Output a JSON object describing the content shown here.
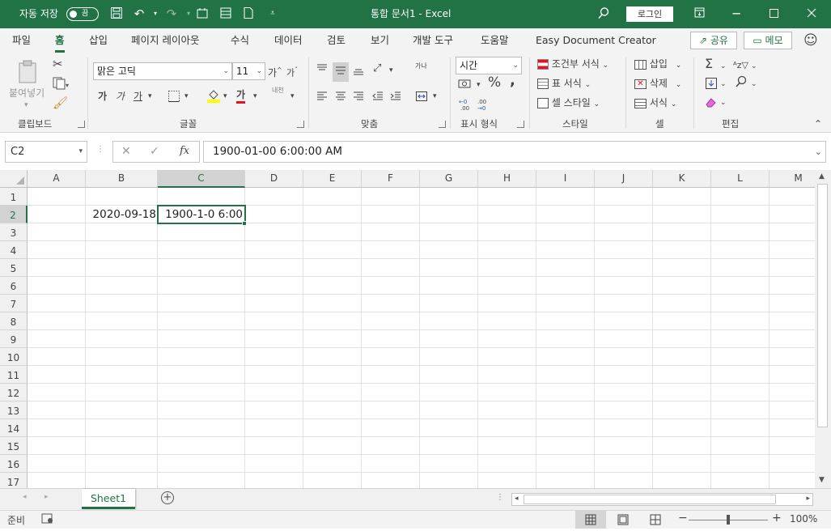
{
  "titlebar": {
    "autosave_label": "자동 저장",
    "autosave_state": "끔",
    "doc_title": "통합 문서1  -  Excel",
    "login_label": "로그인"
  },
  "menu": {
    "tabs": [
      "파일",
      "홈",
      "삽입",
      "페이지 레이아웃",
      "수식",
      "데이터",
      "검토",
      "보기",
      "개발 도구",
      "도움말",
      "Easy Document Creator"
    ],
    "active_tab": "홈",
    "share_label": "공유",
    "memo_label": "메모"
  },
  "ribbon": {
    "clipboard": {
      "paste_label": "붙여넣기",
      "group_label": "클립보드"
    },
    "font": {
      "font_name": "맑은 고딕",
      "font_size": "11",
      "grow": "가",
      "shrink": "가",
      "bold": "가",
      "italic": "가",
      "underline": "가",
      "font_color_glyph": "가",
      "phonetic": "내천",
      "group_label": "글꼴",
      "fill_color": "#ffff00",
      "font_color": "#e81123"
    },
    "alignment": {
      "wrap_label": "가나",
      "group_label": "맞춤"
    },
    "number": {
      "format": "시간",
      "percent": "%",
      "comma": ",",
      "group_label": "표시 형식"
    },
    "styles": {
      "conditional_label": "조건부 서식",
      "table_label": "표 서식",
      "cell_style_label": "셀 스타일",
      "group_label": "스타일"
    },
    "cells": {
      "insert_label": "삽입",
      "delete_label": "삭제",
      "format_label": "서식",
      "group_label": "셀"
    },
    "editing": {
      "group_label": "편집"
    }
  },
  "formula_bar": {
    "name_box": "C2",
    "formula": "1900-01-00  6:00:00 AM",
    "fx": "fx"
  },
  "grid": {
    "columns": [
      "A",
      "B",
      "C",
      "D",
      "E",
      "F",
      "G",
      "H",
      "I",
      "J",
      "K",
      "L",
      "M"
    ],
    "rows": [
      "1",
      "2",
      "3",
      "4",
      "5",
      "6",
      "7",
      "8",
      "9",
      "10",
      "11",
      "12",
      "13",
      "14",
      "15",
      "16",
      "17"
    ],
    "selected_column": "C",
    "selected_row": "2",
    "cells": {
      "B2": "2020-09-18",
      "C2": "1900-1-0 6:00"
    }
  },
  "sheets": {
    "tabs": [
      "Sheet1"
    ],
    "active": "Sheet1"
  },
  "status": {
    "ready": "준비",
    "zoom": "100%"
  },
  "colors": {
    "accent": "#217346"
  }
}
